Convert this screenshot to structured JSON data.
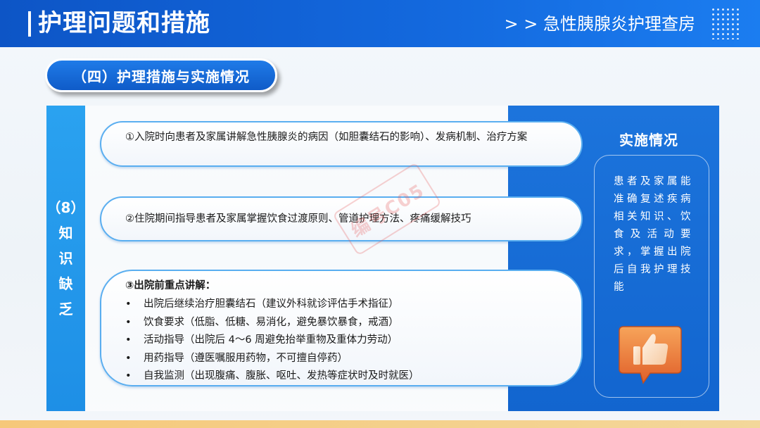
{
  "header": {
    "title": "护理问题和措施",
    "subtitle": "> > 急性胰腺炎护理查房"
  },
  "section": {
    "label": "（四）护理措施与实施情况"
  },
  "problem": {
    "chars": [
      "（8）",
      "知",
      "识",
      "缺",
      "乏"
    ]
  },
  "measures": {
    "item1": "①入院时向患者及家属讲解急性胰腺炎的病因（如胆囊结石的影响）、发病机制、治疗方案",
    "item2": "②住院期间指导患者及家属掌握饮食过渡原则、管道护理方法、疼痛缓解技巧",
    "item3_title": "③出院前重点讲解：",
    "item3_list": [
      "出院后继续治疗胆囊结石（建议外科就诊评估手术指征）",
      "饮食要求（低脂、低糖、易消化，避免暴饮暴食，戒酒）",
      "活动指导（出院后 4～6 周避免抬举重物及重体力劳动）",
      "用药指导（遵医嘱服用药物，不可擅自停药）",
      "自我监测（出现腹痛、腹胀、呕吐、发热等症状时及时就医）"
    ],
    "bullet": "•"
  },
  "implementation": {
    "title": "实施情况",
    "text": "患者及家属能准确复述疾病相关知识、饮食及活动要求，掌握出院后自我护理技能",
    "icon": "thumbs-up-icon"
  },
  "watermark": {
    "text": "编号C05"
  },
  "colors": {
    "primary_blue": "#1368dd",
    "light_blue": "#2aa2f0",
    "accent_orange": "#f08a3c",
    "bottom_bar": "#f6c87a"
  }
}
